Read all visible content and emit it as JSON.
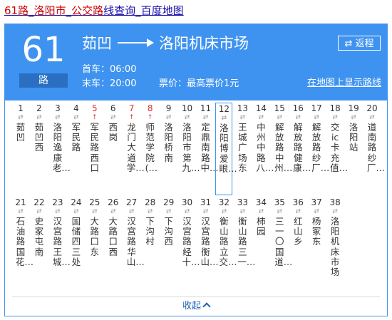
{
  "search_result": {
    "title_parts": [
      "61路",
      "_",
      "洛阳市",
      "_",
      "公交路",
      "线查询",
      "_",
      "百度地图"
    ],
    "highlighted": [
      true,
      false,
      true,
      false,
      true,
      false,
      false,
      false
    ]
  },
  "route": {
    "number": "61",
    "suffix": "路",
    "from": "茹凹",
    "to": "洛阳机床市场",
    "reverse_label": "返程",
    "first_bus": "首车：06:00",
    "last_bus": "末车：20:00",
    "fare": "票价：最高票价1元",
    "map_link": "在地图上显示路线"
  },
  "stops": [
    {
      "n": "1",
      "name": "茹凹"
    },
    {
      "n": "2",
      "name": "茹凹西"
    },
    {
      "n": "3",
      "name": "洛阳逸康老…"
    },
    {
      "n": "4",
      "name": "军民路"
    },
    {
      "n": "5",
      "name": "军民路西口",
      "red": true
    },
    {
      "n": "6",
      "name": "西岗"
    },
    {
      "n": "7",
      "name": "龙门大道学…",
      "red": true
    },
    {
      "n": "8",
      "name": "师范学院(…",
      "red": true
    },
    {
      "n": "9",
      "name": "洛阳桥南"
    },
    {
      "n": "10",
      "name": "洛阳市第九…"
    },
    {
      "n": "11",
      "name": "定鼎南路中…"
    },
    {
      "n": "12",
      "name": "洛阳博爱眼…",
      "selected": true
    },
    {
      "n": "13",
      "name": "王城广场东"
    },
    {
      "n": "14",
      "name": "中州中路八…"
    },
    {
      "n": "15",
      "name": "解放路中州…"
    },
    {
      "n": "16",
      "name": "解放路健康…"
    },
    {
      "n": "17",
      "name": "解放路纱厂…"
    },
    {
      "n": "18",
      "name": "交ic卡充值…"
    },
    {
      "n": "19",
      "name": "洛阳站"
    },
    {
      "n": "20",
      "name": "道南路纱厂…"
    },
    {
      "n": "21",
      "name": "石油路国花…"
    },
    {
      "n": "22",
      "name": "史家屯南"
    },
    {
      "n": "23",
      "name": "汉宫路王城…"
    },
    {
      "n": "24",
      "name": "国储四三处"
    },
    {
      "n": "25",
      "name": "大路口东"
    },
    {
      "n": "26",
      "name": "大路口西"
    },
    {
      "n": "27",
      "name": "汉宫路华山…"
    },
    {
      "n": "28",
      "name": "下沟村"
    },
    {
      "n": "29",
      "name": "下沟西"
    },
    {
      "n": "30",
      "name": "汉宫路经十…"
    },
    {
      "n": "31",
      "name": "汉宫路衡山…"
    },
    {
      "n": "32",
      "name": "衡山路立交…"
    },
    {
      "n": "33",
      "name": "衡山路三一…"
    },
    {
      "n": "34",
      "name": "柿园"
    },
    {
      "n": "35",
      "name": "三一〇国道…"
    },
    {
      "n": "36",
      "name": "红山乡"
    },
    {
      "n": "37",
      "name": "杨冢东"
    },
    {
      "n": "38",
      "name": "洛阳机床市场"
    }
  ],
  "arrow_glyph": "⇄",
  "red_arrow_glyph": "↑",
  "collapse_label": "收起",
  "colors": {
    "header": "#3f93f0",
    "badge": "#2a6fc2",
    "red": "#e03030",
    "link": "#1d5fb9"
  }
}
